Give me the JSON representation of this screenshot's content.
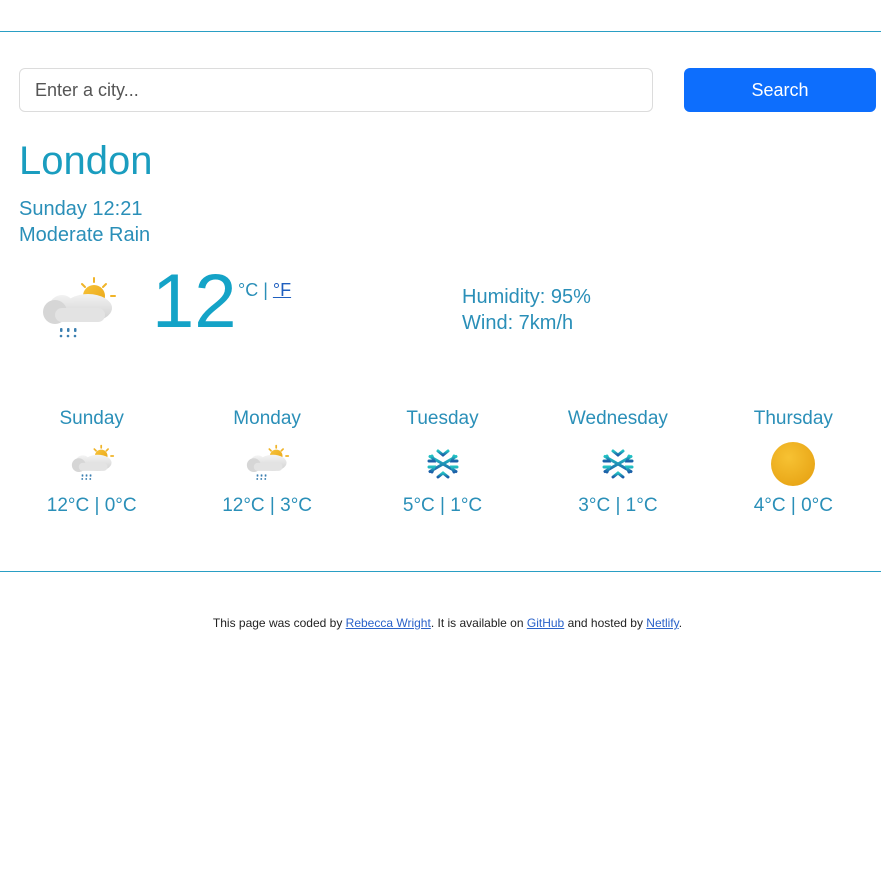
{
  "search": {
    "placeholder": "Enter a city...",
    "value": "",
    "button_label": "Search"
  },
  "current": {
    "city": "London",
    "datetime": "Sunday 12:21",
    "description": "Moderate Rain",
    "icon": "rain-sun-cloud-icon",
    "temperature": "12",
    "unit_celsius": "°C",
    "unit_separator": " | ",
    "unit_fahrenheit": "°F",
    "humidity": "Humidity: 95%",
    "wind": "Wind: 7km/h"
  },
  "forecast": [
    {
      "day": "Sunday",
      "icon": "rain-sun-cloud-icon",
      "temps": "12°C |  0°C"
    },
    {
      "day": "Monday",
      "icon": "rain-sun-cloud-icon",
      "temps": "12°C |  3°C"
    },
    {
      "day": "Tuesday",
      "icon": "snowflake-icon",
      "temps": "5°C |  1°C"
    },
    {
      "day": "Wednesday",
      "icon": "snowflake-icon",
      "temps": "3°C |  1°C"
    },
    {
      "day": "Thursday",
      "icon": "sun-icon",
      "temps": "4°C |  0°C"
    }
  ],
  "footer": {
    "text_1": "This page was coded by ",
    "author_link": "Rebecca Wright",
    "text_2": ". It is available on ",
    "github_link": "GitHub",
    "text_3": " and hosted by ",
    "netlify_link": "Netlify",
    "text_4": "."
  },
  "colors": {
    "accent": "#1a9dbf",
    "button": "#0d6efd",
    "link": "#2a62c9"
  }
}
